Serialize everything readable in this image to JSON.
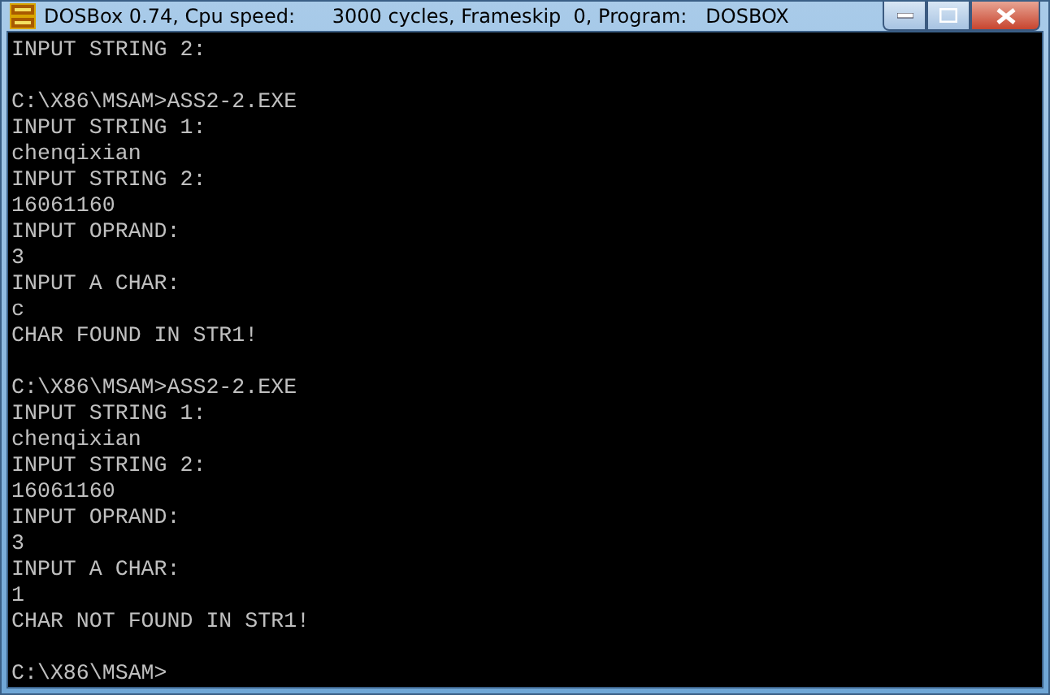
{
  "window": {
    "title": "DOSBox 0.74, Cpu speed:      3000 cycles, Frameskip  0, Program:   DOSBOX",
    "controls": [
      {
        "kind": "minimize"
      },
      {
        "kind": "maximize"
      },
      {
        "kind": "close"
      }
    ]
  },
  "console": {
    "lines": [
      {
        "kind": "text",
        "text": "INPUT STRING 2:"
      },
      {
        "kind": "blank"
      },
      {
        "kind": "text",
        "text": "C:\\X86\\MSAM>ASS2-2.EXE"
      },
      {
        "kind": "text",
        "text": "INPUT STRING 1:"
      },
      {
        "kind": "text",
        "text": "chenqixian"
      },
      {
        "kind": "text",
        "text": "INPUT STRING 2:"
      },
      {
        "kind": "text",
        "text": "16061160"
      },
      {
        "kind": "text",
        "text": "INPUT OPRAND:"
      },
      {
        "kind": "text",
        "text": "3"
      },
      {
        "kind": "text",
        "text": "INPUT A CHAR:"
      },
      {
        "kind": "text",
        "text": "c"
      },
      {
        "kind": "text",
        "text": "CHAR FOUND IN STR1!"
      },
      {
        "kind": "blank"
      },
      {
        "kind": "text",
        "text": "C:\\X86\\MSAM>ASS2-2.EXE"
      },
      {
        "kind": "text",
        "text": "INPUT STRING 1:"
      },
      {
        "kind": "text",
        "text": "chenqixian"
      },
      {
        "kind": "text",
        "text": "INPUT STRING 2:"
      },
      {
        "kind": "text",
        "text": "16061160"
      },
      {
        "kind": "text",
        "text": "INPUT OPRAND:"
      },
      {
        "kind": "text",
        "text": "3"
      },
      {
        "kind": "text",
        "text": "INPUT A CHAR:"
      },
      {
        "kind": "text",
        "text": "1"
      },
      {
        "kind": "text",
        "text": "CHAR NOT FOUND IN STR1!"
      },
      {
        "kind": "blank"
      },
      {
        "kind": "text",
        "text": "C:\\X86\\MSAM>"
      }
    ]
  }
}
